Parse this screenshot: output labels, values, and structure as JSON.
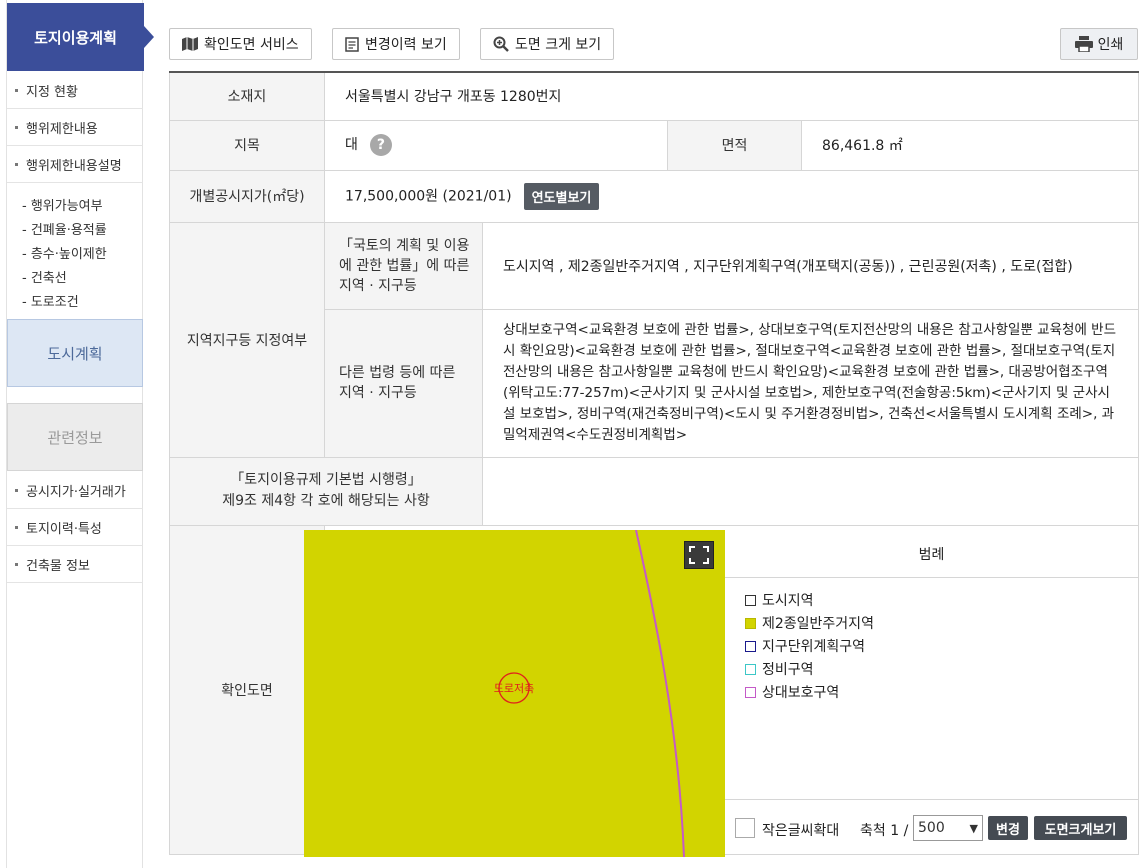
{
  "sidebar": {
    "title": "토지이용계획",
    "items": [
      {
        "label": "지정 현황"
      },
      {
        "label": "행위제한내용"
      },
      {
        "label": "행위제한내용설명"
      }
    ],
    "sub_items": [
      {
        "label": "- 행위가능여부"
      },
      {
        "label": "- 건폐율·용적률"
      },
      {
        "label": "- 층수·높이제한"
      },
      {
        "label": "- 건축선"
      },
      {
        "label": "- 도로조건"
      }
    ],
    "city_plan": "도시계획",
    "related": "관련정보",
    "bottom_items": [
      {
        "label": "공시지가·실거래가"
      },
      {
        "label": "토지이력·특성"
      },
      {
        "label": "건축물 정보"
      }
    ]
  },
  "toolbar": {
    "confirm_map": "확인도면 서비스",
    "history": "변경이력 보기",
    "zoom_map": "도면 크게 보기",
    "print": "인쇄"
  },
  "info": {
    "location_label": "소재지",
    "location_value": "서울특별시 강남구 개포동 1280번지",
    "category_label": "지목",
    "category_value": "대",
    "help_mark": "?",
    "area_label": "면적",
    "area_value": "86,461.8 ㎡",
    "price_label": "개별공시지가(㎡당)",
    "price_value": "17,500,000원 (2021/01)",
    "year_btn": "연도별보기",
    "zone_label": "지역지구등 지정여부",
    "zone_law1_label": "「국토의 계획 및 이용에 관한 법률」에 따른 지역 · 지구등",
    "zone_law1_value": "도시지역 , 제2종일반주거지역 , 지구단위계획구역(개포택지(공동)) , 근린공원(저촉) , 도로(접합)",
    "zone_law2_label": "다른 법령 등에 따른 지역 · 지구등",
    "zone_law2_value": "상대보호구역<교육환경 보호에 관한 법률>, 상대보호구역(토지전산망의 내용은 참고사항일뿐 교육청에 반드시 확인요망)<교육환경 보호에 관한 법률>, 절대보호구역<교육환경 보호에 관한 법률>, 절대보호구역(토지전산망의 내용은 참고사항일뿐 교육청에 반드시 확인요망)<교육환경 보호에 관한 법률>, 대공방어협조구역(위탁고도:77-257m)<군사기지 및 군사시설 보호법>, 제한보호구역(전술항공:5km)<군사기지 및 군사시설 보호법>, 정비구역(재건축정비구역)<도시 및 주거환경정비법>, 건축선<서울특별시 도시계획 조례>, 과밀억제권역<수도권정비계획법>",
    "enforce_label_1": "「토지이용규제 기본법 시행령」",
    "enforce_label_2": "제9조 제4항 각 호에 해당되는 사항",
    "enforce_value": "",
    "map_label": "확인도면"
  },
  "map": {
    "marker_text": "도로저촉",
    "zone_color": "#d2d400",
    "line_color": "#c45ac8"
  },
  "legend": {
    "title": "범례",
    "items": [
      {
        "label": "도시지역",
        "color": "#333333",
        "fill": "#ffffff"
      },
      {
        "label": "제2종일반주거지역",
        "color": "#b8b800",
        "fill": "#d2d400"
      },
      {
        "label": "지구단위계획구역",
        "color": "#1a1a8c",
        "fill": "#ffffff"
      },
      {
        "label": "정비구역",
        "color": "#3cc7c7",
        "fill": "#ffffff"
      },
      {
        "label": "상대보호구역",
        "color": "#c45ac8",
        "fill": "#ffffff"
      }
    ]
  },
  "map_controls": {
    "small_text": "작은글씨확대",
    "scale_label": "축척 1 /",
    "scale_value": "500",
    "change_btn": "변경",
    "big_btn": "도면크게보기"
  }
}
